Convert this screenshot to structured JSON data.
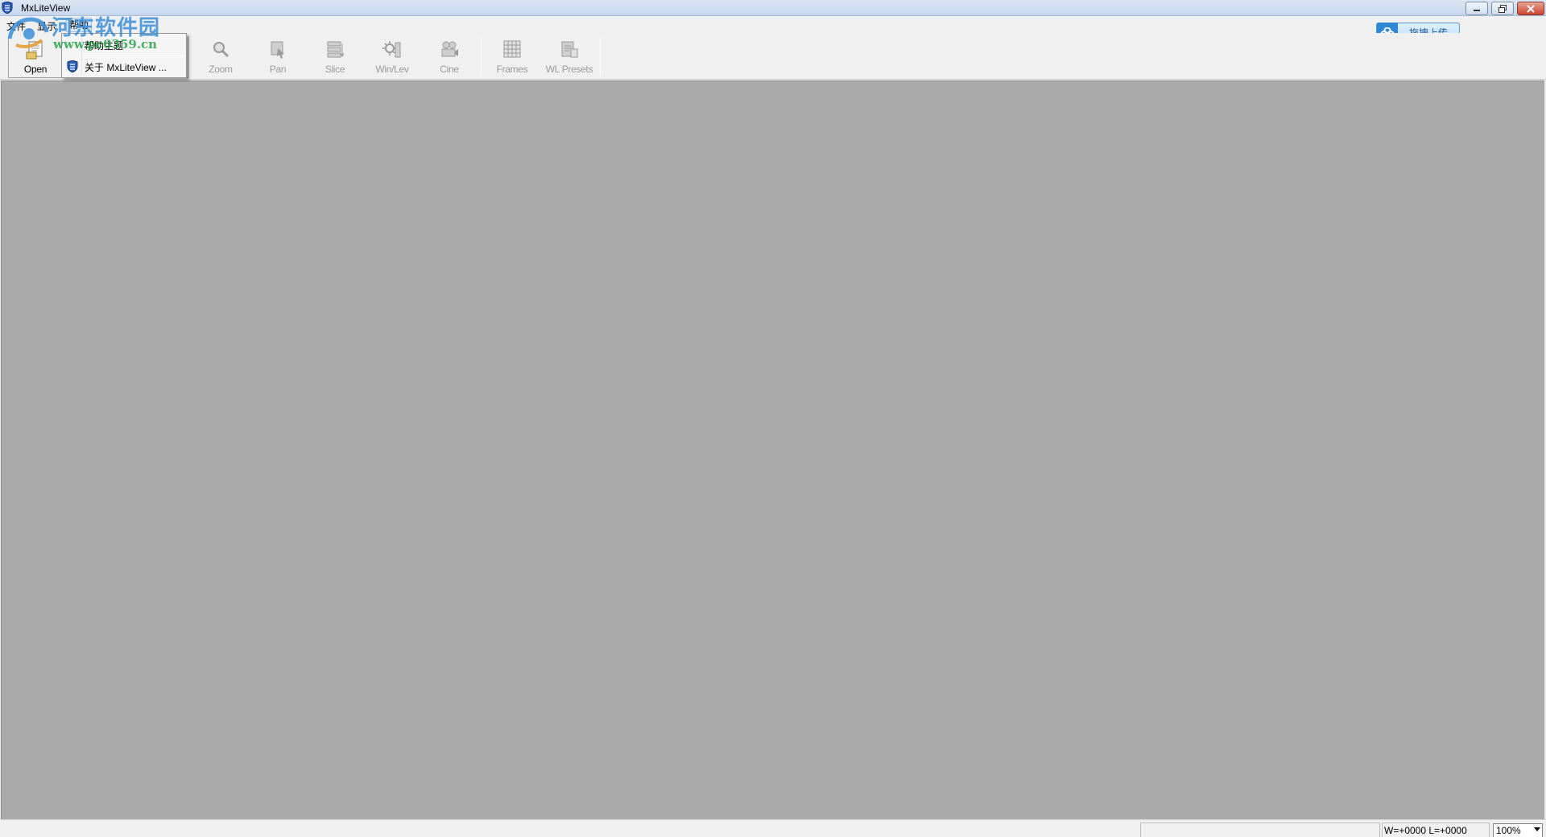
{
  "window": {
    "title": "MxLiteView"
  },
  "menubar": {
    "file": "文件",
    "view": "显示",
    "help": "帮助"
  },
  "help_menu": {
    "items": [
      {
        "label": "帮助主题"
      },
      {
        "label": "关于 MxLiteView ..."
      }
    ]
  },
  "toolbar": {
    "open": "Open",
    "zoom": "Zoom",
    "pan": "Pan",
    "slice": "Slice",
    "winlev": "Win/Lev",
    "cine": "Cine",
    "frames": "Frames",
    "wl_presets": "WL Presets"
  },
  "upload": {
    "label": "拖拽上传"
  },
  "statusbar": {
    "wl_readout": "W=+0000  L=+0000",
    "zoom_value": "100%"
  },
  "watermark": {
    "title": "河东软件园",
    "url": "www.pc0359.cn"
  },
  "colors": {
    "canvas": "#aaaaaa",
    "accent": "#2d86d6",
    "titlebar": "#c6d6ec"
  }
}
